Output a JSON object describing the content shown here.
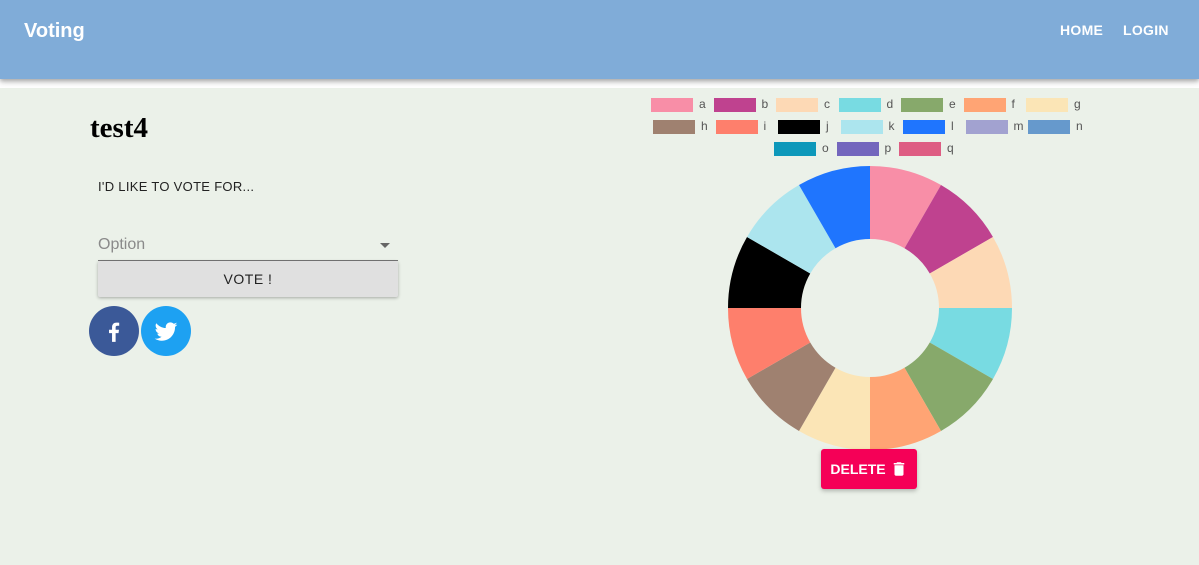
{
  "appbar": {
    "brand": "Voting",
    "nav": {
      "home": "HOME",
      "login": "LOGIN"
    },
    "color": "#80acd8"
  },
  "poll": {
    "title": "test4",
    "prompt": "I'D LIKE TO VOTE FOR...",
    "select_placeholder": "Option",
    "vote_label": "VOTE !",
    "delete_label": "DELETE"
  },
  "social": [
    {
      "name": "facebook",
      "icon": "facebook-icon",
      "color": "#3b5998"
    },
    {
      "name": "twitter",
      "icon": "twitter-icon",
      "color": "#1da1f2"
    }
  ],
  "chart_data": {
    "type": "pie",
    "variant": "doughnut",
    "legend_position": "top",
    "categories": [
      "a",
      "b",
      "c",
      "d",
      "e",
      "f",
      "g",
      "h",
      "i",
      "j",
      "k",
      "l",
      "m",
      "n",
      "o",
      "p",
      "q"
    ],
    "values": [
      1,
      1,
      1,
      1,
      1,
      1,
      1,
      1,
      1,
      1,
      1,
      1,
      0,
      0,
      0,
      0,
      0
    ],
    "colors": [
      "#f88ea7",
      "#bf428f",
      "#fdd9b5",
      "#78dbe2",
      "#87a96b",
      "#ffa474",
      "#fbe5b6",
      "#9f8170",
      "#fe7f6c",
      "#000000",
      "#ace5ee",
      "#1f75fe",
      "#a2a2d0",
      "#6699cc",
      "#0d98ba",
      "#7366bd",
      "#de5d83"
    ]
  }
}
